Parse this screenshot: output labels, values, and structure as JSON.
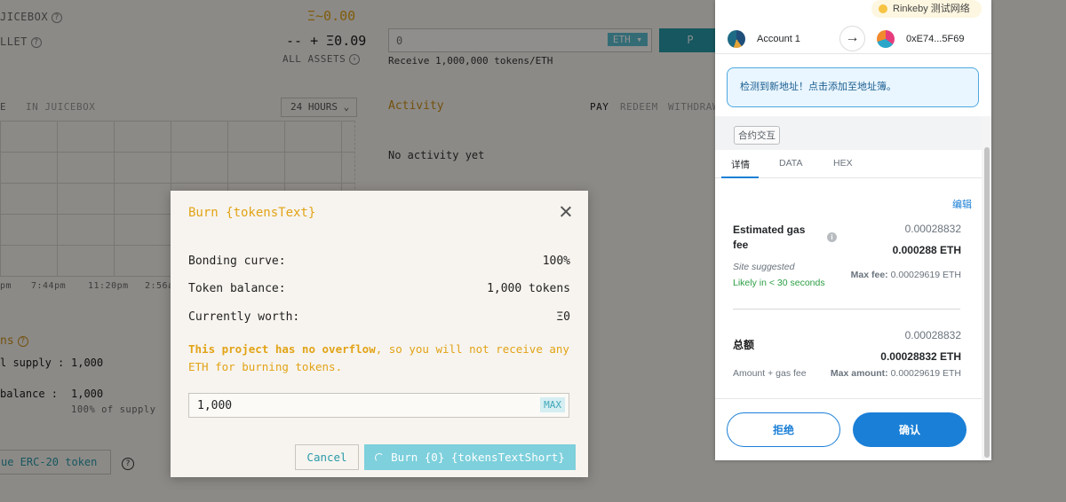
{
  "background": {
    "juicebox_label": "JICEBOX",
    "juicebox_value": "Ξ~0.00",
    "wallet_label": "LLET",
    "wallet_value": "-- + Ξ0.09",
    "all_assets": "ALL ASSETS",
    "amount_placeholder": "0",
    "currency": "ETH ▾",
    "pay_button": "P",
    "receive_text": "Receive 1,000,000 tokens/ETH",
    "tab_e": "E",
    "tab_in_juicebox": "IN JUICEBOX",
    "time_range": "24 HOURS",
    "time_range_chevron": "⌄",
    "activity_title": "Activity",
    "activity_tabs": [
      "PAY",
      "REDEEM",
      "WITHDRAW"
    ],
    "no_activity": "No activity yet",
    "chart_ticks": [
      "pm",
      "7:44pm",
      "11:20pm",
      "2:56a"
    ],
    "tokens_label": "ns",
    "supply_label": "l supply :",
    "supply_value": "1,000",
    "balance_label": " balance :",
    "balance_value": "1,000",
    "percent_supply": "100% of supply",
    "issue_button": "ue ERC-20 token"
  },
  "modal": {
    "title": "Burn {tokensText}",
    "rows": [
      {
        "label": "Bonding curve:",
        "value": "100%"
      },
      {
        "label": "Token balance:",
        "value": "1,000 tokens"
      },
      {
        "label": "Currently worth:",
        "value": "Ξ0"
      }
    ],
    "warning_bold": "This project has no overflow",
    "warning_rest": ", so you will not receive any ETH for burning tokens.",
    "amount_value": "1,000",
    "max_label": "MAX",
    "cancel_label": "Cancel",
    "burn_label": "Burn {0} {tokensTextShort}",
    "accent_color": "#e2a316",
    "teal_color": "#7dd0dc"
  },
  "metamask": {
    "network": "Rinkeby 测试网络",
    "account_name": "Account 1",
    "to_address": "0xE74...5F69",
    "notice": "检测到新地址！点击添加至地址簿。",
    "contract_tag": "合约交互",
    "tabs": [
      "详情",
      "DATA",
      "HEX"
    ],
    "edit_label": "编辑",
    "gas_fee_title": "Estimated gas fee",
    "gas_fee_value": "0.00028832",
    "gas_fee_eth": "0.000288 ETH",
    "site_suggested": "Site suggested",
    "likely_time": "Likely in < 30 seconds",
    "max_fee_label": "Max fee:",
    "max_fee_value": "0.00029619 ETH",
    "total_title": "总额",
    "total_value": "0.00028832",
    "total_eth": "0.00028832 ETH",
    "amount_gas_label": "Amount + gas fee",
    "max_amount_label": "Max amount:",
    "max_amount_value": "0.00029619 ETH",
    "reject_label": "拒绝",
    "confirm_label": "确认",
    "primary_color": "#1a7fd6"
  }
}
